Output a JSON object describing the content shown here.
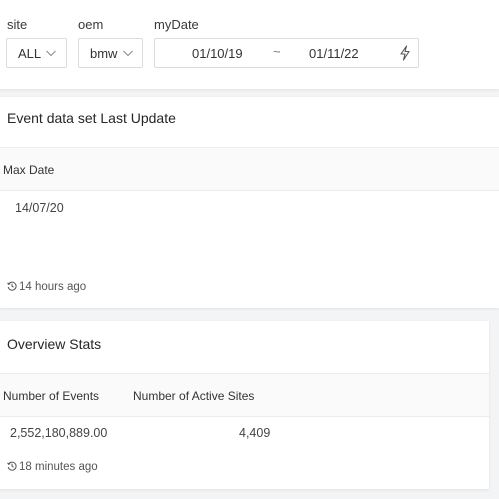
{
  "filters": {
    "site": {
      "label": "site",
      "value": "ALL"
    },
    "oem": {
      "label": "oem",
      "value": "bmw"
    },
    "date": {
      "label": "myDate",
      "start": "01/10/19",
      "separator": "~",
      "end": "01/11/22"
    }
  },
  "panel_last_update": {
    "title": "Event data set Last Update",
    "columns": [
      "Max Date"
    ],
    "rows": [
      [
        "14/07/20"
      ]
    ],
    "footer": "14 hours ago"
  },
  "panel_overview": {
    "title": "Overview Stats",
    "columns": [
      "Number of Events",
      "Number of Active Sites"
    ],
    "rows": [
      [
        "2,552,180,889.00",
        "4,409"
      ]
    ],
    "footer": "18 minutes ago"
  },
  "icons": {
    "chevron": "chevron-down-icon",
    "apply": "lightning-icon",
    "history": "history-clock-icon"
  }
}
